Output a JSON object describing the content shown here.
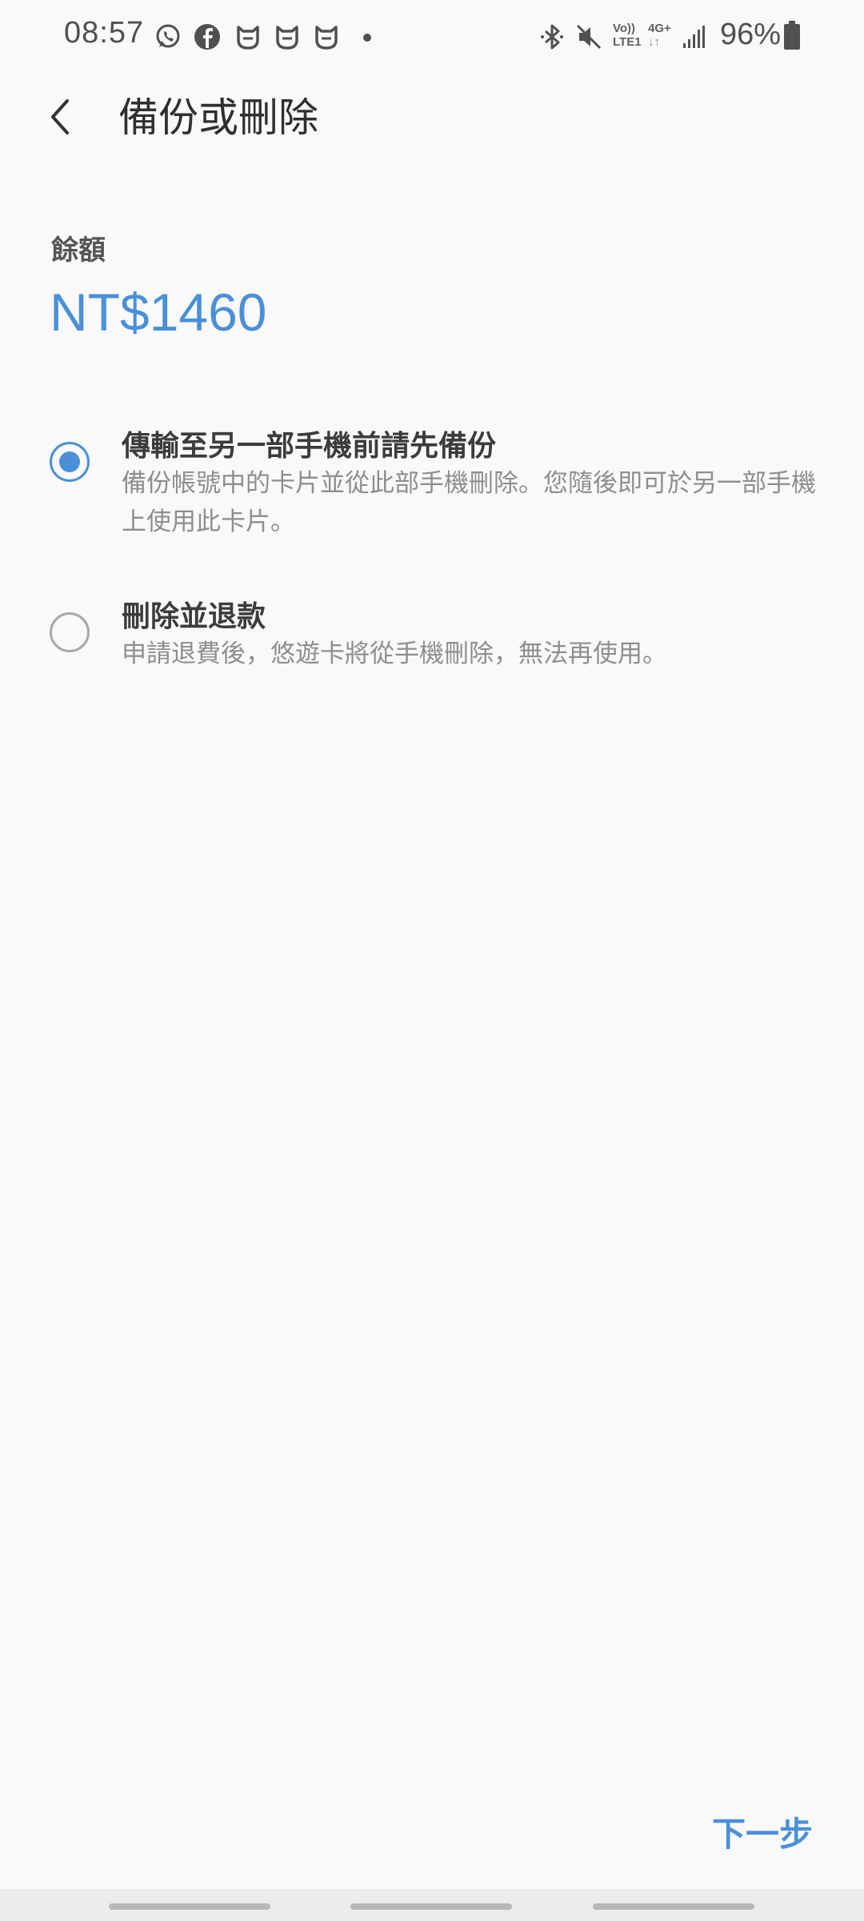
{
  "status_bar": {
    "time": "08:57",
    "left_icons": [
      "whatsapp-icon",
      "facebook-icon",
      "mi-icon",
      "mi-icon",
      "mi-icon"
    ],
    "volte_top": "Vo))",
    "volte_bottom": "LTE1",
    "network_top": "4G+",
    "network_bottom": "↓↑",
    "battery": "96%"
  },
  "header": {
    "title": "備份或刪除"
  },
  "balance": {
    "label": "餘額",
    "value": "NT$1460"
  },
  "options": [
    {
      "title": "傳輸至另一部手機前請先備份",
      "description": "備份帳號中的卡片並從此部手機刪除。您隨後即可於另一部手機上使用此卡片。",
      "selected": true
    },
    {
      "title": "刪除並退款",
      "description": "申請退費後，悠遊卡將從手機刪除，無法再使用。",
      "selected": false
    }
  ],
  "footer": {
    "next_label": "下一步"
  },
  "colors": {
    "accent": "#4a90d9",
    "background": "#f9f9f9"
  }
}
